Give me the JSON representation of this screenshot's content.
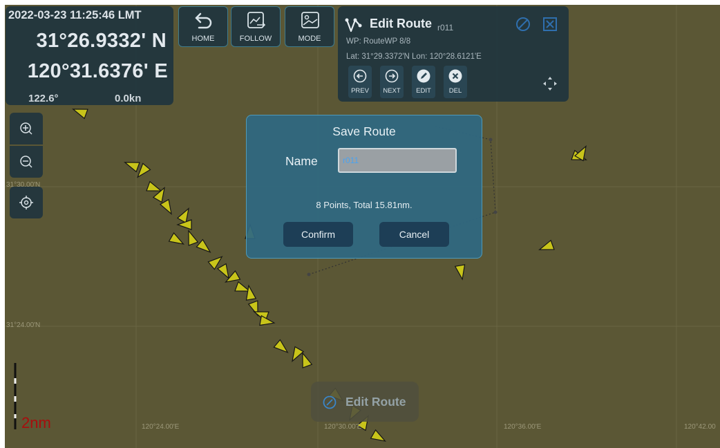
{
  "gps": {
    "datetime": "2022-03-23 11:25:46 LMT",
    "latitude": "31°26.9332' N",
    "longitude": "120°31.6376' E",
    "heading": "122.6°",
    "speed": "0.0kn"
  },
  "toolbar": {
    "home_label": "HOME",
    "follow_label": "FOLLOW",
    "mode_label": "MODE"
  },
  "edit_panel": {
    "title": "Edit Route",
    "route_id": "r011",
    "waypoint": "WP:  RouteWP 8/8",
    "latlon": "Lat:  31°29.3372'N  Lon:  120°28.6121'E",
    "buttons": {
      "prev": "PREV",
      "next": "NEXT",
      "edit": "EDIT",
      "del": "DEL"
    }
  },
  "map": {
    "lat_labels": [
      "31°30.00'N",
      "31°24.00'N"
    ],
    "lon_labels": [
      "120°24.00'E",
      "120°30.00'E",
      "120°36.00'E",
      "120°42.00"
    ],
    "scale": "2nm"
  },
  "dialog": {
    "title": "Save Route",
    "name_label": "Name",
    "name_value": "r011",
    "summary": "8 Points, Total 15.81nm.",
    "confirm_label": "Confirm",
    "cancel_label": "Cancel"
  },
  "toast": {
    "label": "Edit Route"
  },
  "colors": {
    "map_bg": "#5b5735",
    "panel_bg": "#1f343e",
    "dialog_bg": "#2f6882",
    "ship_fill": "#c8c41a",
    "scale_red": "#a80d0d"
  }
}
